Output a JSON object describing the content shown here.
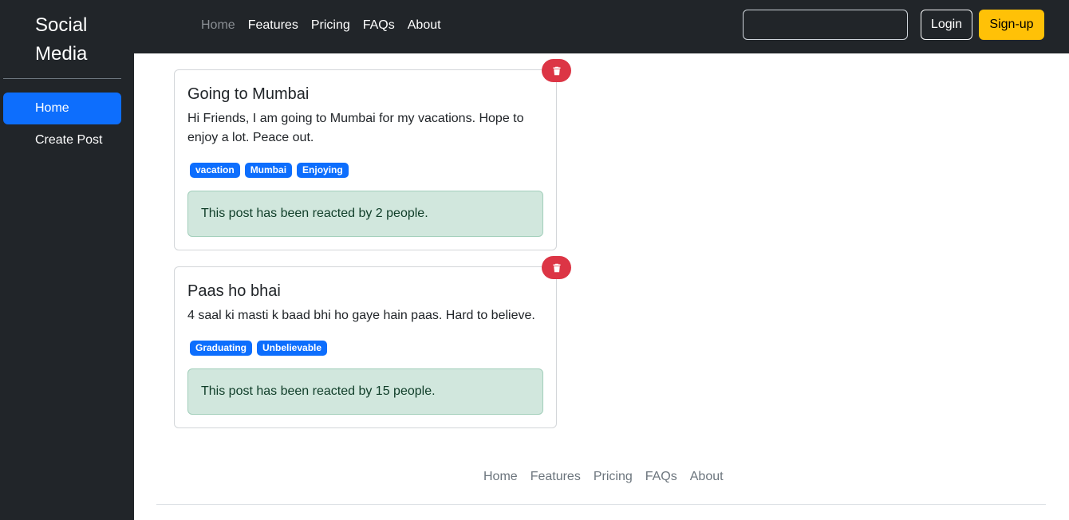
{
  "sidebar": {
    "brand": "Social Media",
    "items": [
      {
        "label": "Home",
        "active": true
      },
      {
        "label": "Create Post",
        "active": false
      }
    ]
  },
  "header": {
    "nav": [
      {
        "label": "Home",
        "active": true
      },
      {
        "label": "Features",
        "active": false
      },
      {
        "label": "Pricing",
        "active": false
      },
      {
        "label": "FAQs",
        "active": false
      },
      {
        "label": "About",
        "active": false
      }
    ],
    "search": {
      "value": "",
      "placeholder": ""
    },
    "login_label": "Login",
    "signup_label": "Sign-up"
  },
  "posts": [
    {
      "title": "Going to Mumbai",
      "body": "Hi Friends, I am going to Mumbai for my vacations. Hope to enjoy a lot. Peace out.",
      "tags": [
        "vacation",
        "Mumbai",
        "Enjoying"
      ],
      "reactions_text": "This post has been reacted by 2 people.",
      "delete_icon": "trash-icon"
    },
    {
      "title": "Paas ho bhai",
      "body": "4 saal ki masti k baad bhi ho gaye hain paas. Hard to believe.",
      "tags": [
        "Graduating",
        "Unbelievable"
      ],
      "reactions_text": "This post has been reacted by 15 people.",
      "delete_icon": "trash-icon"
    }
  ],
  "footer": {
    "nav": [
      "Home",
      "Features",
      "Pricing",
      "FAQs",
      "About"
    ]
  },
  "colors": {
    "dark": "#212529",
    "primary": "#0d6efd",
    "warning": "#ffc107",
    "danger": "#dc3545",
    "success_bg": "#d1e7dd"
  }
}
